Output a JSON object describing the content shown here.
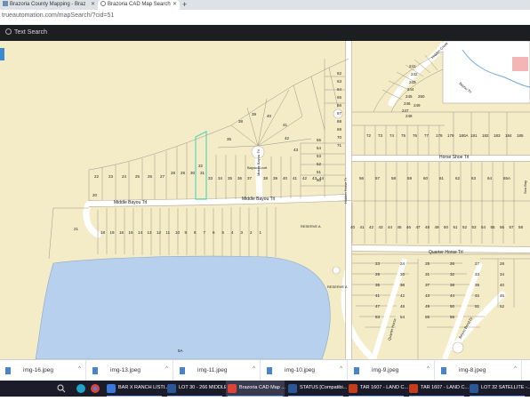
{
  "browser": {
    "tabs": [
      {
        "title": "Brazoria County Mapping - Braz",
        "active": false,
        "icon": "map-favicon"
      },
      {
        "title": "Brazoria CAD Map Search",
        "active": true,
        "icon": "globe-favicon"
      }
    ],
    "new_tab_label": "+",
    "address": "trueautomation.com/mapSearch/?cid=51"
  },
  "app": {
    "search_label": "Text Search",
    "search_icon": "search-icon"
  },
  "map": {
    "roads": [
      "Middle Bayou Trl",
      "Middle Bayou Trl",
      "Horse Shoe Trl",
      "Quarter Horse Trl",
      "Bayou Court",
      "Middle Bayou Trl",
      "Hidden Horse Tr",
      "Bayou Trl",
      "Hidden Creek",
      "Bayou Bend Dr",
      "Quarter Horse",
      "Sea Bay"
    ],
    "reserves": [
      "RESERVE A",
      "RESERVE A"
    ],
    "lot_labels": {
      "north_strip": [
        "22",
        "23",
        "24",
        "25",
        "26",
        "27",
        "28",
        "29",
        "30",
        "31",
        "32"
      ],
      "north_cul_de_sac": [
        "33",
        "34",
        "35",
        "36",
        "37",
        "38",
        "39",
        "40",
        "41",
        "42",
        "43",
        "44",
        "45",
        "46",
        "47",
        "48",
        "49"
      ],
      "north_middle": [
        "55",
        "54",
        "53",
        "52",
        "51",
        "50",
        "57",
        "58",
        "60",
        "61"
      ],
      "fan_lots": [
        "35",
        "38",
        "39",
        "40",
        "41",
        "42",
        "43"
      ],
      "west_lot": "20",
      "south_row": [
        "21",
        "18",
        "19",
        "16",
        "15",
        "14",
        "13",
        "12",
        "11",
        "10",
        "9",
        "8",
        "7",
        "6",
        "5",
        "4",
        "3",
        "2",
        "1"
      ],
      "east_col": [
        "62",
        "63",
        "64",
        "65",
        "66",
        "67",
        "68",
        "69",
        "70",
        "71"
      ],
      "northeast": [
        "72",
        "73",
        "74",
        "75",
        "76",
        "77",
        "178",
        "179",
        "180A",
        "181",
        "182",
        "183",
        "184",
        "185"
      ],
      "horse_shoe_south": [
        "56",
        "57",
        "58",
        "59",
        "60",
        "61",
        "62",
        "63",
        "64",
        "65A"
      ],
      "quarter_south": [
        "40",
        "41",
        "42",
        "43",
        "44",
        "45",
        "46",
        "47",
        "48",
        "49",
        "50",
        "51",
        "52",
        "53",
        "54",
        "55",
        "56",
        "57",
        "58"
      ],
      "loop_top": [
        "241",
        "242",
        "243",
        "244",
        "245",
        "246",
        "247",
        "248",
        "249",
        "250"
      ],
      "southeast": [
        "23",
        "24",
        "25",
        "26",
        "27",
        "28",
        "29",
        "30",
        "31",
        "32",
        "33",
        "34",
        "35",
        "36",
        "37",
        "38",
        "39",
        "40",
        "41",
        "42",
        "43",
        "44",
        "45",
        "46",
        "47",
        "48",
        "49",
        "50",
        "51",
        "52",
        "53",
        "54",
        "55",
        "56"
      ],
      "lake": "5A"
    }
  },
  "downloads": [
    {
      "name": "img-16.jpeg"
    },
    {
      "name": "img-13.jpeg"
    },
    {
      "name": "img-11.jpeg"
    },
    {
      "name": "img-10.jpeg"
    },
    {
      "name": "img-9.jpeg"
    },
    {
      "name": "img-8.jpeg"
    }
  ],
  "taskbar": [
    {
      "title": "BAR X RANCH LISTI...",
      "active": false
    },
    {
      "title": "LOT 30 - 266 MIDDLE...",
      "active": false
    },
    {
      "title": "Brazoria CAD Map ...",
      "active": true
    },
    {
      "title": "STATUS [Compatibi...",
      "active": false
    },
    {
      "title": "TAR 1607 - LAND C...",
      "active": false
    },
    {
      "title": "TAR 1607 - LAND C...",
      "active": false
    },
    {
      "title": "LOT 32 SATELLITE -...",
      "active": false
    }
  ],
  "colors": {
    "map_bg": "#f4ecc6",
    "water": "#b7d0ee",
    "road": "#ffffff",
    "lot_line": "#9a9486",
    "highlight": "#59d6b8",
    "app_header": "#1d1e21"
  }
}
